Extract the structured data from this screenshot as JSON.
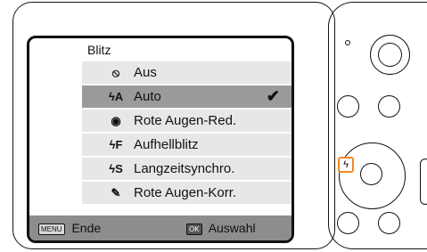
{
  "menu": {
    "title": "Blitz",
    "items": [
      {
        "icon": "⦸",
        "label": "Aus"
      },
      {
        "icon": "ϟA",
        "label": "Auto"
      },
      {
        "icon": "◉",
        "label": "Rote Augen-Red."
      },
      {
        "icon": "ϟF",
        "label": "Aufhellblitz"
      },
      {
        "icon": "ϟS",
        "label": "Langzeitsynchro."
      },
      {
        "icon": "✎",
        "label": "Rote Augen-Korr."
      }
    ],
    "selected_index": 1,
    "checkmark": "✔"
  },
  "bottom_bar": {
    "menu_key": "MENU",
    "menu_label": "Ende",
    "ok_key": "OK",
    "ok_label": "Auswahl"
  },
  "camera": {
    "flash_button_icon": "ϟ",
    "flash_highlight_color": "#f08a24"
  }
}
